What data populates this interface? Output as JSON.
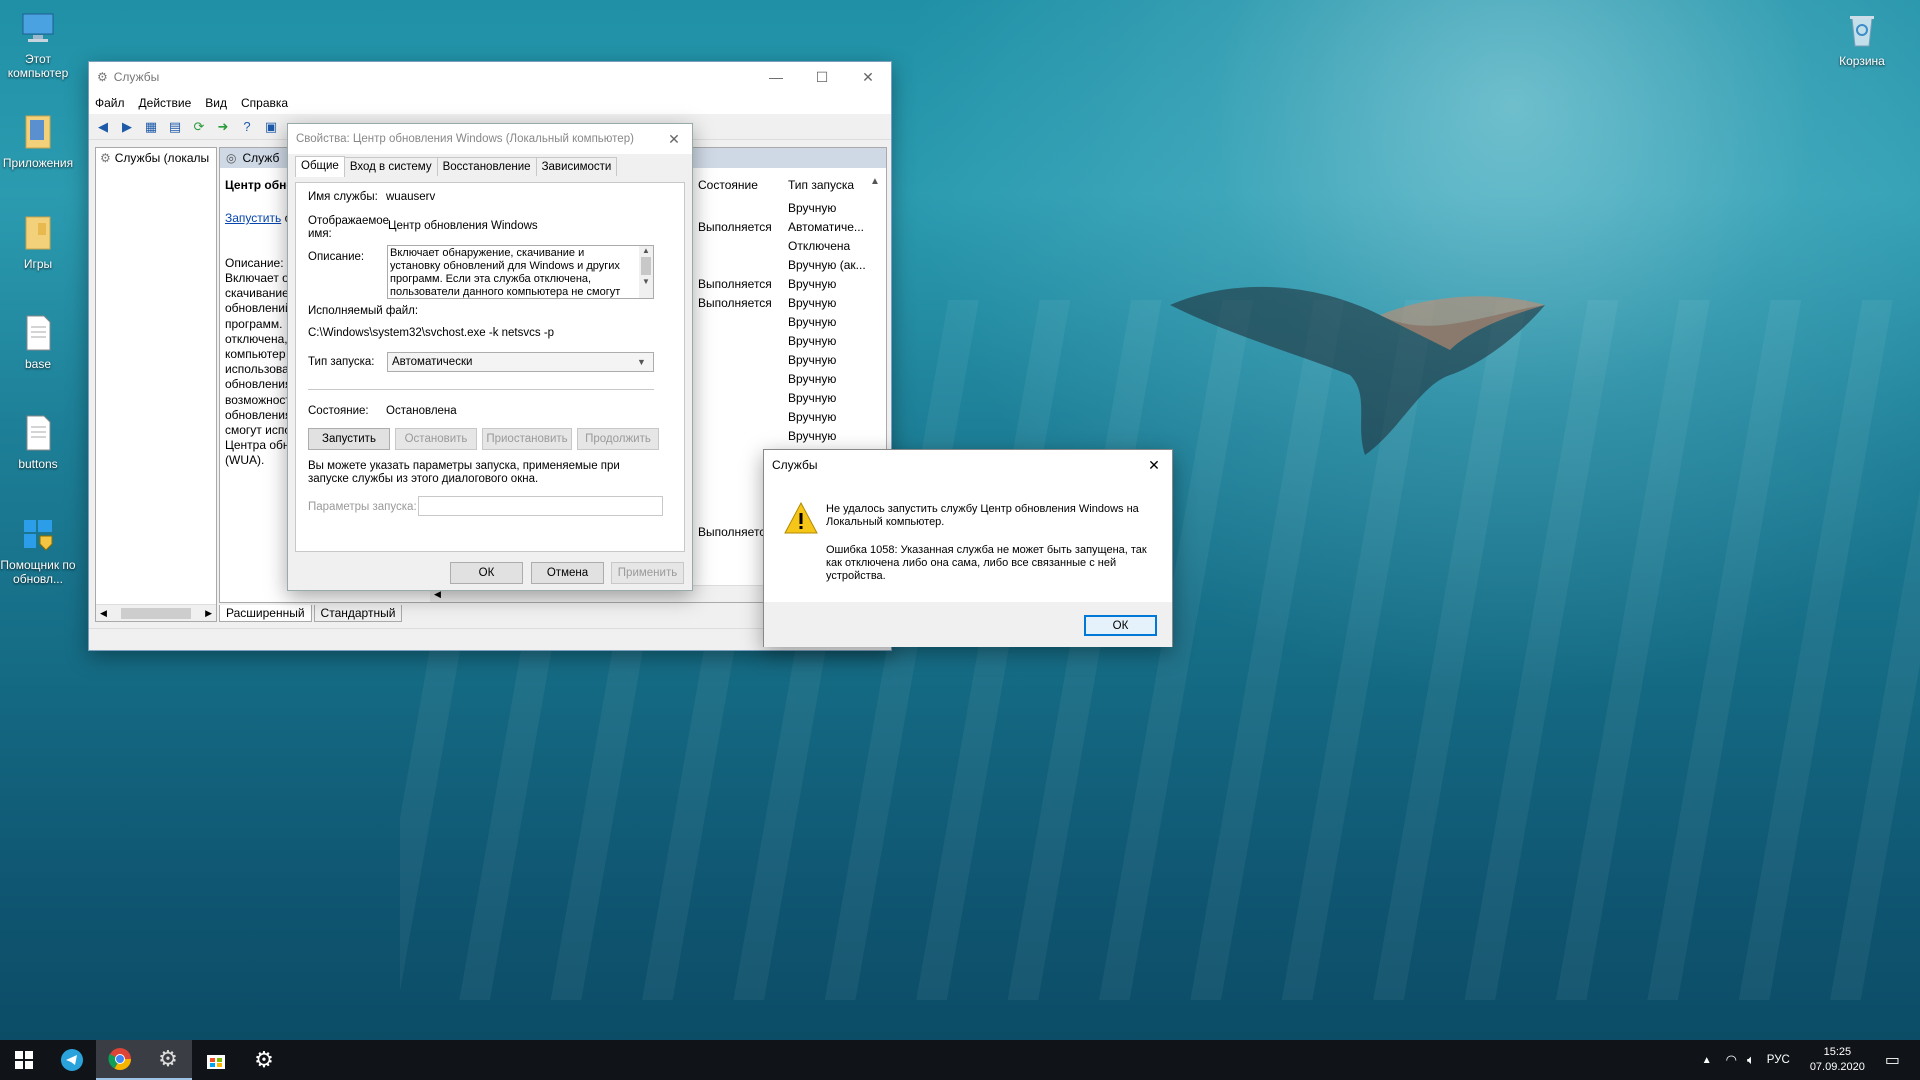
{
  "desktop": {
    "icons": [
      {
        "label": "Этот компьютер",
        "icon": "computer-icon"
      },
      {
        "label": "Приложения",
        "icon": "folder-icon"
      },
      {
        "label": "Игры",
        "icon": "folder-icon"
      },
      {
        "label": "base",
        "icon": "document-icon"
      },
      {
        "label": "buttons",
        "icon": "document-icon"
      },
      {
        "label": "Помощник по обновл...",
        "icon": "windows-update-assistant-icon"
      },
      {
        "label": "Корзина",
        "icon": "recycle-bin-icon"
      }
    ]
  },
  "services_window": {
    "title": "Службы",
    "menu": [
      "Файл",
      "Действие",
      "Вид",
      "Справка"
    ],
    "tree_item": "Службы (локалы",
    "header_item": "Служб",
    "detail": {
      "heading": "Центр обно",
      "start_link": "Запустить",
      "start_suffix": "с",
      "desc_label": "Описание:",
      "desc_lines": [
        "Включает о",
        "скачивание",
        "обновлений",
        "программ.",
        "отключена,",
        "компьютер",
        "использова",
        "обновления",
        "возможност",
        "обновления",
        "смогут испо",
        "Центра обн",
        "(WUA)."
      ]
    },
    "columns": {
      "status": "Состояние",
      "startup": "Тип запуска"
    },
    "rows": [
      {
        "status": "",
        "startup": "Вручную"
      },
      {
        "status": "Выполняется",
        "startup": "Автоматиче..."
      },
      {
        "status": "",
        "startup": "Отключена"
      },
      {
        "status": "",
        "startup": "Вручную (ак..."
      },
      {
        "status": "Выполняется",
        "startup": "Вручную"
      },
      {
        "status": "Выполняется",
        "startup": "Вручную"
      },
      {
        "status": "",
        "startup": "Вручную"
      },
      {
        "status": "",
        "startup": "Вручную"
      },
      {
        "status": "",
        "startup": "Вручную"
      },
      {
        "status": "",
        "startup": "Вручную"
      },
      {
        "status": "",
        "startup": "Вручную"
      },
      {
        "status": "",
        "startup": "Вручную"
      },
      {
        "status": "",
        "startup": "Вручную"
      }
    ],
    "extra_status": "Выполняется",
    "bottom_tabs": [
      "Расширенный",
      "Стандартный"
    ]
  },
  "properties_dialog": {
    "title": "Свойства: Центр обновления Windows (Локальный компьютер)",
    "tabs": [
      "Общие",
      "Вход в систему",
      "Восстановление",
      "Зависимости"
    ],
    "service_name_label": "Имя службы:",
    "service_name": "wuauserv",
    "display_name_label": "Отображаемое имя:",
    "display_name": "Центр обновления Windows",
    "description_label": "Описание:",
    "description": "Включает обнаружение, скачивание и установку обновлений для Windows и других программ. Если эта служба отключена, пользователи данного компьютера не смогут использовать",
    "exec_label": "Исполняемый файл:",
    "exec_path": "C:\\Windows\\system32\\svchost.exe -k netsvcs -p",
    "startup_label": "Тип запуска:",
    "startup_value": "Автоматически",
    "state_label": "Состояние:",
    "state_value": "Остановлена",
    "buttons": {
      "start": "Запустить",
      "stop": "Остановить",
      "pause": "Приостановить",
      "resume": "Продолжить"
    },
    "hint": "Вы можете указать параметры запуска, применяемые при запуске службы из этого диалогового окна.",
    "params_label": "Параметры запуска:",
    "params_value": "",
    "ok": "ОК",
    "cancel": "Отмена",
    "apply": "Применить"
  },
  "error_dialog": {
    "title": "Службы",
    "message": "Не удалось запустить службу Центр обновления Windows на Локальный компьютер.",
    "error": "Ошибка 1058: Указанная служба не может быть запущена, так как отключена либо она сама, либо все связанные с ней устройства.",
    "ok": "ОК"
  },
  "taskbar": {
    "apps": [
      "telegram-icon",
      "chrome-icon",
      "services-gear-icon",
      "store-icon",
      "settings-gear-icon"
    ],
    "lang": "РУС",
    "time": "15:25",
    "date": "07.09.2020"
  },
  "colors": {
    "accent": "#0078d7",
    "taskbar": "#101418",
    "warning": "#f5c518"
  }
}
